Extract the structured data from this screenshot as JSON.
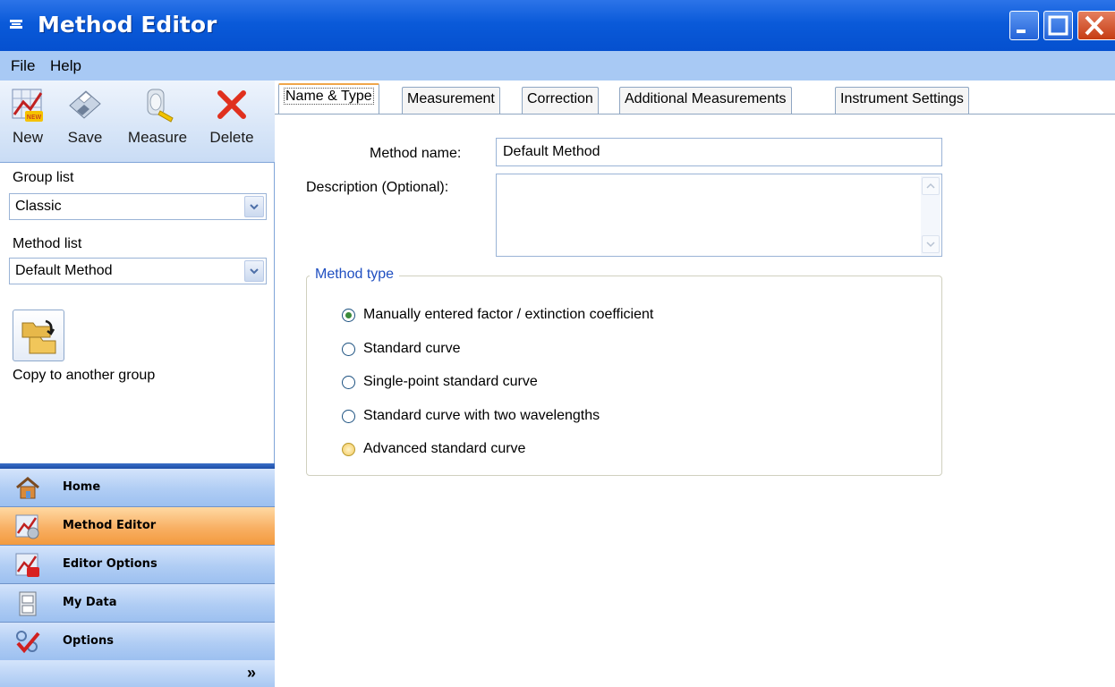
{
  "window": {
    "title": "Method Editor"
  },
  "menu": {
    "items": [
      "File",
      "Help"
    ]
  },
  "toolbar": {
    "new_label": "New",
    "save_label": "Save",
    "measure_label": "Measure",
    "delete_label": "Delete"
  },
  "sidebar": {
    "group_list_label": "Group list",
    "group_list_value": "Classic",
    "method_list_label": "Method list",
    "method_list_value": "Default Method",
    "copy_label": "Copy to another group"
  },
  "nav": {
    "items": [
      {
        "label": "Home",
        "icon": "house-icon",
        "active": false
      },
      {
        "label": "Method Editor",
        "icon": "method-editor-icon",
        "active": true
      },
      {
        "label": "Editor Options",
        "icon": "editor-options-icon",
        "active": false
      },
      {
        "label": "My Data",
        "icon": "cabinet-icon",
        "active": false
      },
      {
        "label": "Options",
        "icon": "checkmark-icon",
        "active": false
      }
    ],
    "expand_glyph": "»"
  },
  "tabs": [
    "Name & Type",
    "Measurement",
    "Correction",
    "Additional Measurements",
    "Instrument Settings"
  ],
  "form": {
    "method_name_label": "Method name:",
    "method_name_value": "Default Method",
    "description_label": "Description (Optional):",
    "description_value": ""
  },
  "method_type": {
    "title": "Method type",
    "options": [
      "Manually entered factor / extinction coefficient",
      "Standard curve",
      "Single-point standard curve",
      "Standard curve with two wavelengths",
      "Advanced standard curve"
    ],
    "selected": 0
  },
  "colors": {
    "titlebar": "#0a5ad9",
    "menubar": "#a8c9f4",
    "active_nav": "#f8b064",
    "group_title": "#1f4fc1"
  }
}
